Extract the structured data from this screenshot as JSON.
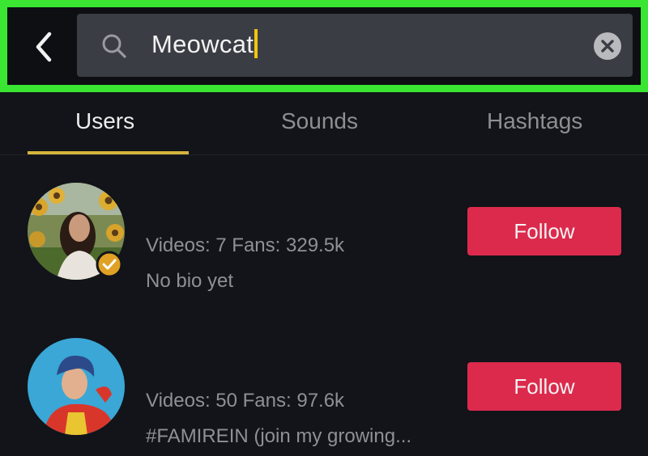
{
  "search": {
    "query": "Meowcat"
  },
  "tabs": [
    {
      "label": "Users",
      "active": true
    },
    {
      "label": "Sounds",
      "active": false
    },
    {
      "label": "Hashtags",
      "active": false
    }
  ],
  "icons": {
    "back": "chevron-left-icon",
    "search": "search-icon",
    "clear": "close-circle-icon",
    "verified": "check-badge-icon"
  },
  "colors": {
    "highlight": "#3ae632",
    "accent_underline": "#d4b43b",
    "follow_button": "#dc2a4d",
    "verified_badge": "#e0a124",
    "cursor": "#f1c40f"
  },
  "users": [
    {
      "stats": "Videos: 7 Fans: 329.5k",
      "bio": "No bio yet",
      "verified": true,
      "follow_label": "Follow"
    },
    {
      "stats": "Videos: 50 Fans: 97.6k",
      "bio": "#FAMIREIN (join my growing...",
      "verified": false,
      "follow_label": "Follow"
    }
  ]
}
